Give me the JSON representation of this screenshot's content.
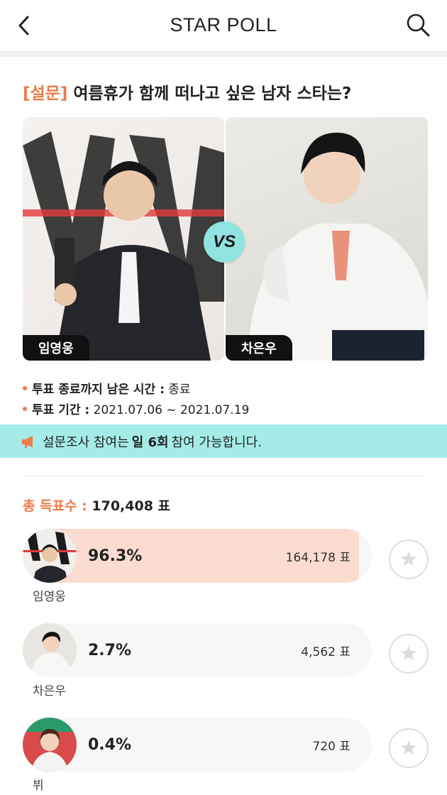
{
  "header": {
    "title": "STAR POLL"
  },
  "poll": {
    "tag": "[설문]",
    "question": "여름휴가 함께 떠나고 싶은 남자 스타는?",
    "vs_label": "VS",
    "candidates": [
      {
        "name": "임영웅"
      },
      {
        "name": "차은우"
      }
    ],
    "remaining_label": "투표 종료까지 남은 시간 :",
    "remaining_value": "종료",
    "period_label": "투표 기간 :",
    "period_value": "2021.07.06 ~ 2021.07.19",
    "notice_pre": "설문조사 참여는",
    "notice_bold": "일 6회",
    "notice_post": "참여 가능합니다.",
    "total_label": "총 득표수 :",
    "total_value": "170,408 표"
  },
  "results": [
    {
      "name": "임영웅",
      "percent": "96.3%",
      "votes": "164,178 표",
      "share": 0.963
    },
    {
      "name": "차은우",
      "percent": "2.7%",
      "votes": "4,562 표",
      "share": 0.027
    },
    {
      "name": "뷔",
      "percent": "0.4%",
      "votes": "720 표",
      "share": 0.004
    }
  ],
  "colors": {
    "accent": "#ee7b4a",
    "notice_bg": "#a5ece8",
    "leader_fill": "#fcdcd0",
    "vs_bg": "#8fe3e0"
  },
  "icons": {
    "back": "chevron-left-icon",
    "search": "search-icon",
    "notice": "megaphone-icon",
    "favorite": "star-bubble-icon"
  }
}
